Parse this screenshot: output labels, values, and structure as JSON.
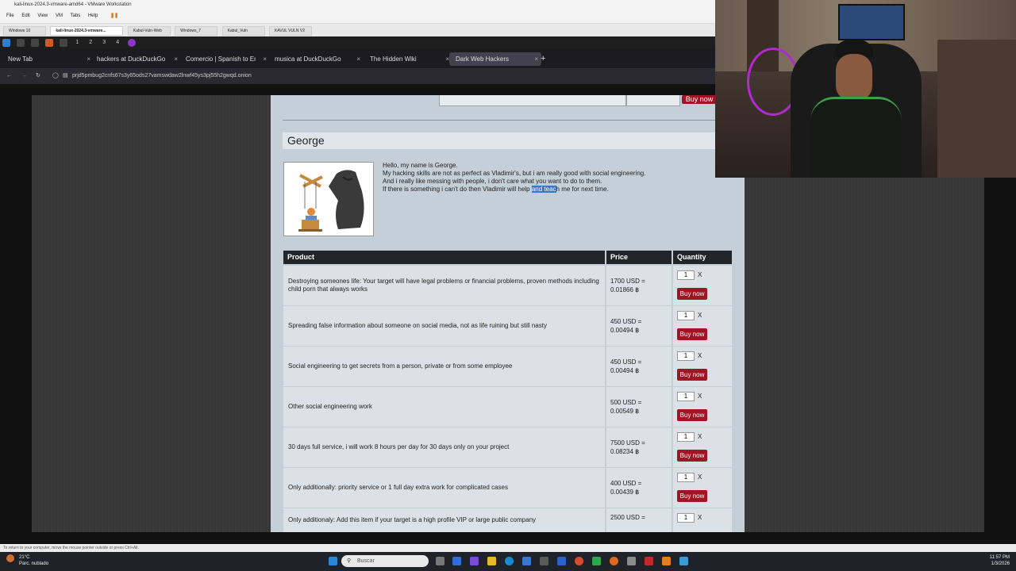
{
  "vm": {
    "title": "kali-linux-2024.3-vmware-amd64 - VMware Workstation",
    "menu": [
      "File",
      "Edit",
      "View",
      "VM",
      "Tabs",
      "Help"
    ],
    "tabs": [
      "Windows 10",
      "kali-linux-2024.3-vmware...",
      "Kabul-Vuln-Web",
      "Windows_7",
      "Kabul_Vuln",
      "KAVUL VULN V2"
    ],
    "status_hint": "To return to your computer, move the mouse pointer outside or press Ctrl+Alt."
  },
  "kali": {
    "workspaces": [
      "1",
      "2",
      "3",
      "4"
    ]
  },
  "browser": {
    "tabs": [
      {
        "label": "New Tab"
      },
      {
        "label": "hackers at DuckDuckGo"
      },
      {
        "label": "Comercio | Spanish to En"
      },
      {
        "label": "musica at DuckDuckGo"
      },
      {
        "label": "The Hidden Wiki"
      },
      {
        "label": "Dark Web Hackers"
      }
    ],
    "new_tab": "+",
    "url": "prjd5pmbug2cnfs67s3y65ods27vamswdaw2lnwf45ys3pj55h2gwqd.onion"
  },
  "page": {
    "top_buy_label": "Buy now",
    "hacker_name": "George",
    "bio": {
      "line1": "Hello, my name is George.",
      "line2": "My hacking skills are not as perfect as Vladimir's, but i am really good with social engineering.",
      "line3": "And i really like messing with people, i don't care what you want to do to them.",
      "line4_a": "If there is something i can't do then Vladimir will help ",
      "line4_hl": "and teac",
      "line4_b": "h me for next time."
    },
    "table": {
      "headers": {
        "product": "Product",
        "price": "Price",
        "quantity": "Quantity"
      },
      "rows": [
        {
          "product": "Destroying someones life: Your target will have legal problems or financial problems, proven methods including child porn that always works",
          "usd": "1700 USD =",
          "btc": "0.01866 ฿",
          "qty": "1"
        },
        {
          "product": "Spreading false information about someone on social media, not as life ruining but still nasty",
          "usd": "450 USD =",
          "btc": "0.00494 ฿",
          "qty": "1"
        },
        {
          "product": "Social engineering to get secrets from a person, private or from some employee",
          "usd": "450 USD =",
          "btc": "0.00494 ฿",
          "qty": "1"
        },
        {
          "product": "Other social engineering work",
          "usd": "500 USD =",
          "btc": "0.00549 ฿",
          "qty": "1"
        },
        {
          "product": "30 days full service, i will work 8 hours per day for 30 days only on your project",
          "usd": "7500 USD =",
          "btc": "0.08234 ฿",
          "qty": "1"
        },
        {
          "product": "Only additionally: priority service or 1 full day extra work for complicated cases",
          "usd": "400 USD =",
          "btc": "0.00439 ฿",
          "qty": "1"
        },
        {
          "product": "Only additionaly: Add this item if your target is a high profile VIP or large public company",
          "usd": "2500 USD =",
          "btc": "",
          "qty": "1"
        }
      ],
      "x_label": "X",
      "buy_label": "Buy now"
    }
  },
  "windows": {
    "weather_temp": "21°C",
    "weather_desc": "Parc. nublado",
    "search_placeholder": "Buscar",
    "time": "11:57 PM",
    "date": "1/3/2026"
  },
  "colors": {
    "buy_button": "#a01424",
    "table_header": "#22262a",
    "page_bg": "#c5cfd8",
    "highlight": "#3d75c9"
  }
}
